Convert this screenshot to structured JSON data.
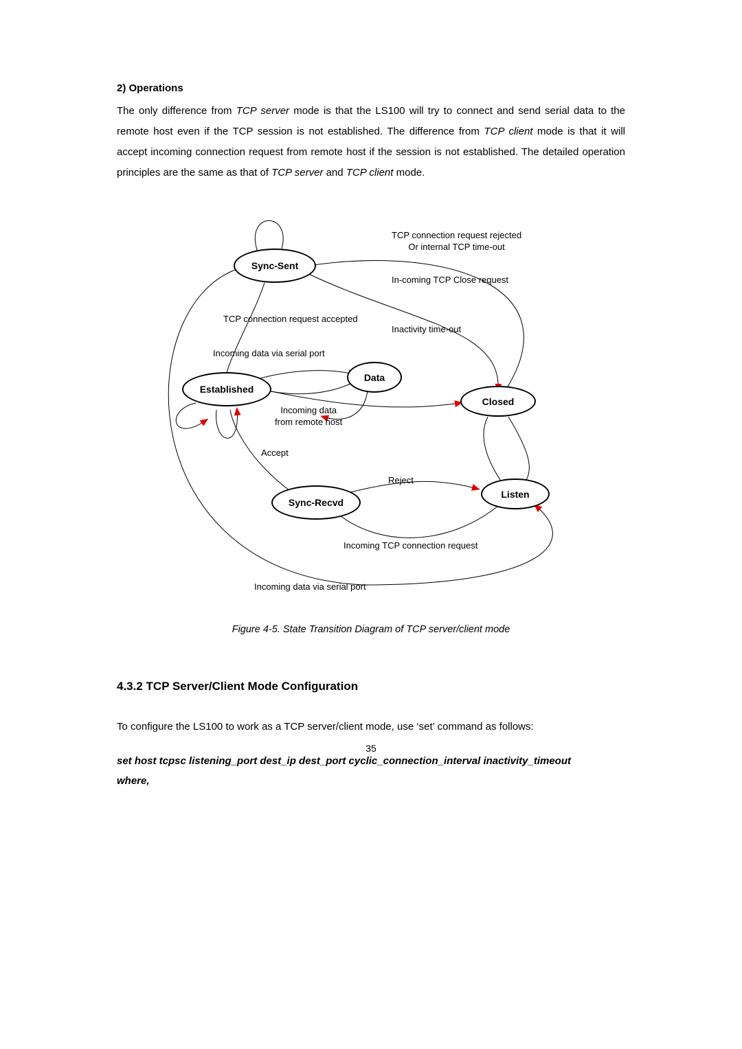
{
  "section": {
    "ops_heading": "2) Operations",
    "ops_para_1": "The only difference from ",
    "ops_para_2_i": "TCP server",
    "ops_para_3": " mode is that the LS100 will try to connect and send serial data to the remote host even if the TCP session is not established. The difference from ",
    "ops_para_4_i": "TCP client",
    "ops_para_5": " mode is that it will accept incoming connection request from remote host if the session is not established. The detailed operation principles are the same as that of ",
    "ops_para_6_i": "TCP server",
    "ops_para_7": " and ",
    "ops_para_8_i": "TCP client",
    "ops_para_9": " mode."
  },
  "diagram": {
    "states": {
      "sync_sent": "Sync-Sent",
      "established": "Established",
      "data": "Data",
      "closed": "Closed",
      "sync_recvd": "Sync-Recvd",
      "listen": "Listen"
    },
    "labels": {
      "rej_line1": "TCP connection request rejected",
      "rej_line2": "Or internal TCP time-out",
      "incoming_close": "In-coming TCP Close request",
      "accepted": "TCP connection request accepted",
      "inactivity": "Inactivity time-out",
      "serial_in_top": "Incoming data via serial port",
      "incoming_remote_1": "Incoming data",
      "incoming_remote_2": "from remote host",
      "accept": "Accept",
      "reject": "Reject",
      "incoming_tcp_req": "Incoming TCP connection request",
      "serial_in_bottom": "Incoming data via serial port"
    },
    "caption": "Figure 4-5. State Transition Diagram of TCP server/client mode"
  },
  "config": {
    "heading": "4.3.2 TCP Server/Client Mode Configuration",
    "intro": "To configure the LS100 to work as a TCP server/client mode, use ‘set’ command as follows:",
    "cmd_line": "set host tcpsc listening_port dest_ip dest_port cyclic_connection_interval inactivity_timeout",
    "where": "where,"
  },
  "page_number": "35"
}
